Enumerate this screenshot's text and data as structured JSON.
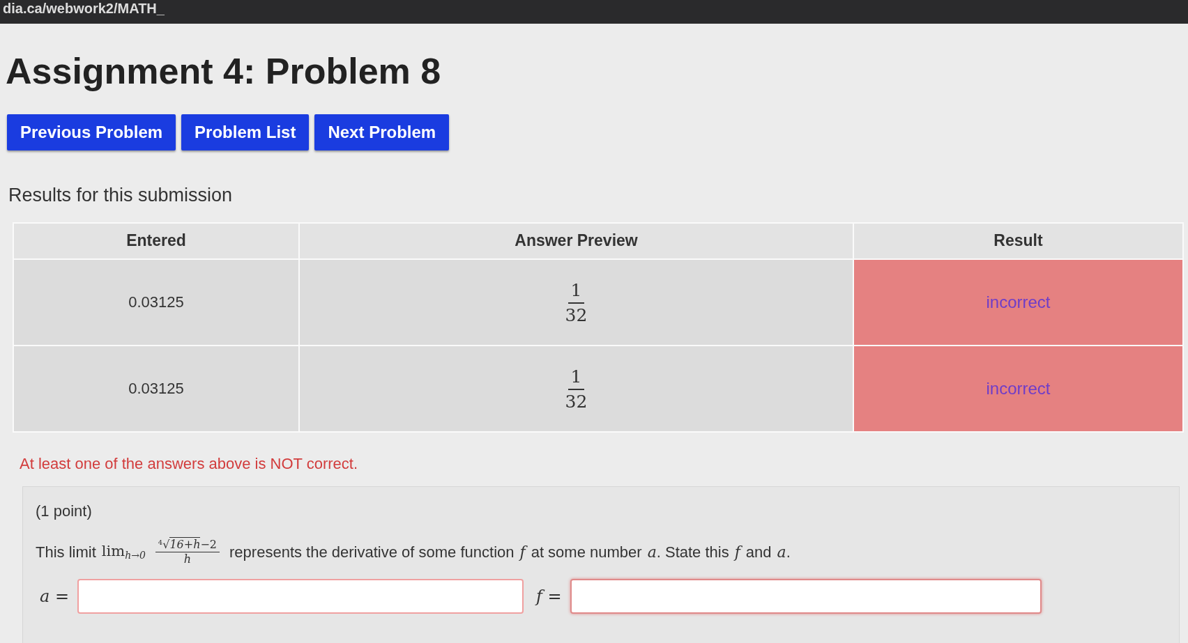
{
  "address_bar": {
    "url": "dia.ca/webwork2/MATH_"
  },
  "title": "Assignment 4: Problem 8",
  "nav_buttons": [
    "Previous Problem",
    "Problem List",
    "Next Problem"
  ],
  "results_heading": "Results for this submission",
  "table": {
    "columns": [
      "Entered",
      "Answer Preview",
      "Result"
    ],
    "rows": [
      {
        "entered": "0.03125",
        "numerator": "1",
        "denominator": "32",
        "result": "incorrect",
        "correct": false
      },
      {
        "entered": "0.03125",
        "numerator": "1",
        "denominator": "32",
        "result": "incorrect",
        "correct": false
      }
    ]
  },
  "message": "At least one of the answers above is NOT correct.",
  "problem": {
    "points": "(1 point)",
    "prompt": {
      "intro": "This limit",
      "lim": "lim",
      "lim_sub": "h→0",
      "root_index": "4",
      "radical": "√",
      "radicand": "16+h",
      "minus": "−2",
      "denominator": "h",
      "text1": "represents the derivative of some function",
      "var_f": "f",
      "text2": "at some number",
      "var_a": "a",
      "text3": ". State this",
      "var_f2": "f",
      "text4": "and",
      "var_a2": "a",
      "text5": "."
    },
    "fields": [
      {
        "label": "a",
        "equals": "=",
        "focused": false
      },
      {
        "label": "f",
        "equals": "=",
        "focused": true
      }
    ]
  }
}
